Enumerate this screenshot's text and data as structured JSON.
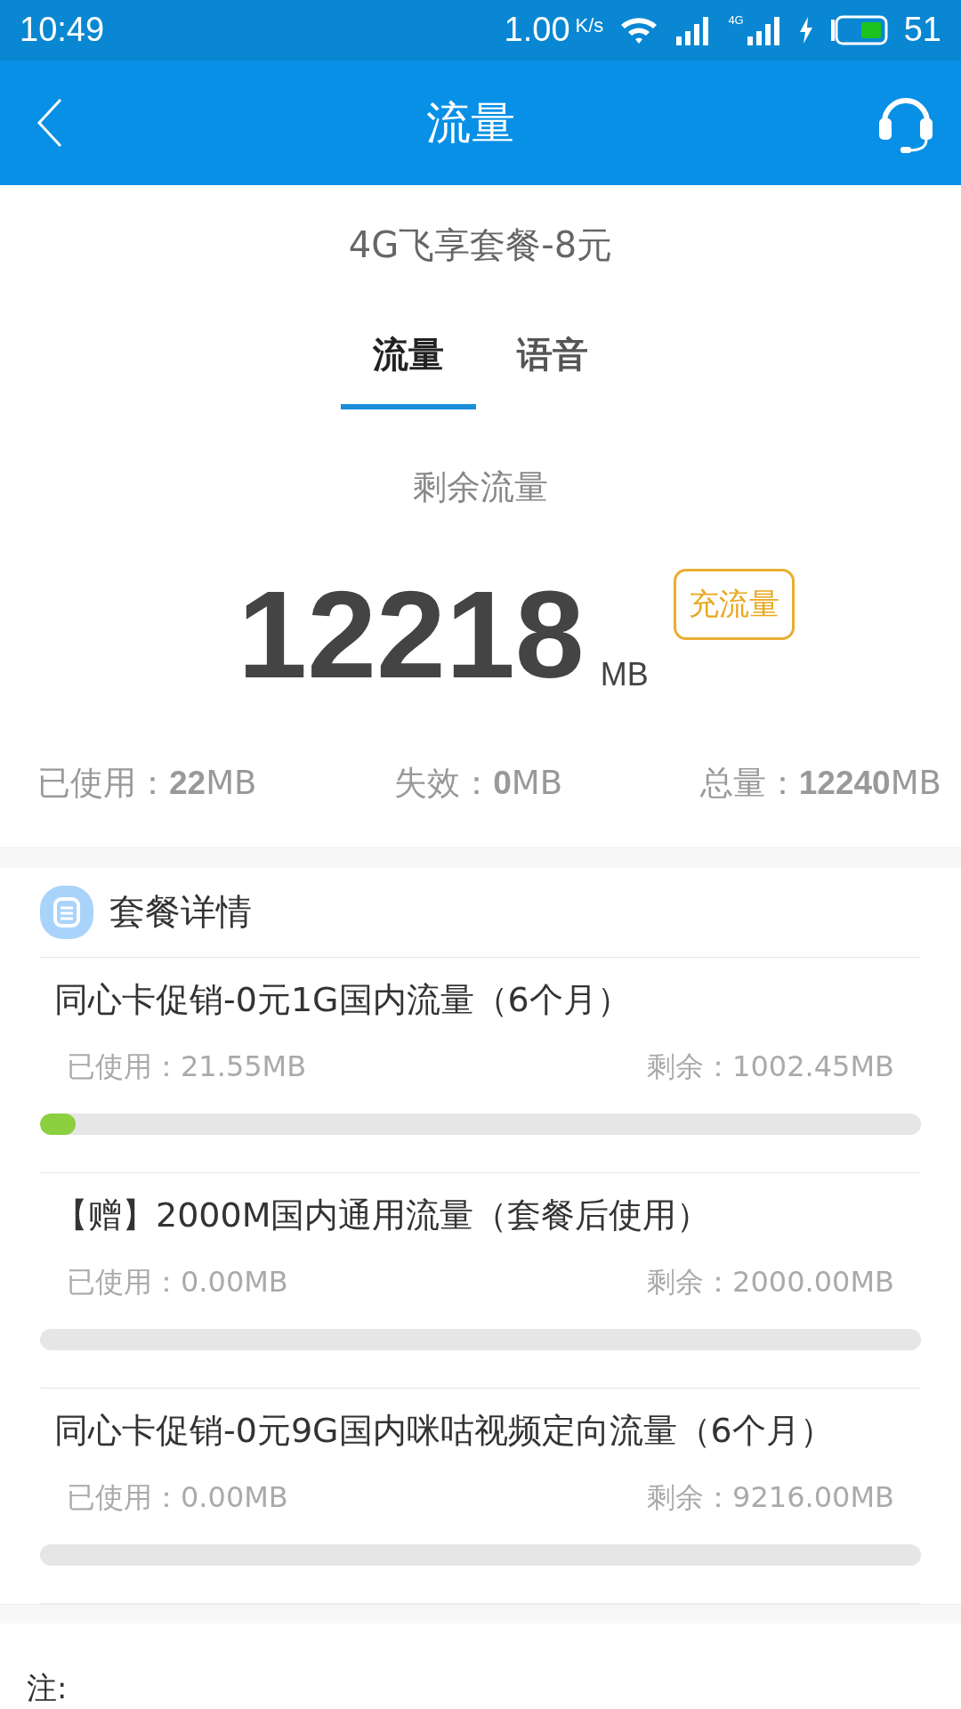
{
  "status_bar": {
    "time": "10:49",
    "speed": "1.00",
    "speed_unit": "K/s",
    "network": "4G",
    "battery": "51"
  },
  "header": {
    "title": "流量"
  },
  "plan": {
    "name": "4G飞享套餐-8元"
  },
  "tabs": [
    {
      "label": "流量",
      "selected": true
    },
    {
      "label": "语音",
      "selected": false
    }
  ],
  "remaining": {
    "label": "剩余流量",
    "value": "12218",
    "unit": "MB",
    "action": "充流量"
  },
  "summary": [
    "已使用：**22**MB",
    "失效：**0**MB",
    "总量：**12240**MB"
  ],
  "details": {
    "title": "套餐详情",
    "items": [
      {
        "name": "同心卡促销-0元1G国内流量（6个月）",
        "used": "已使用：21.55MB",
        "left": "剩余：1002.45MB",
        "level": 0.021
      },
      {
        "name": "【赠】2000M国内通用流量（套餐后使用）",
        "used": "已使用：0.00MB",
        "left": "剩余：2000.00MB"
      },
      {
        "name": "同心卡促销-0元9G国内咪咕视频定向流量（6个月）",
        "used": "已使用：0.00MB",
        "left": "剩余：9216.00MB"
      }
    ]
  },
  "note": "注:"
}
